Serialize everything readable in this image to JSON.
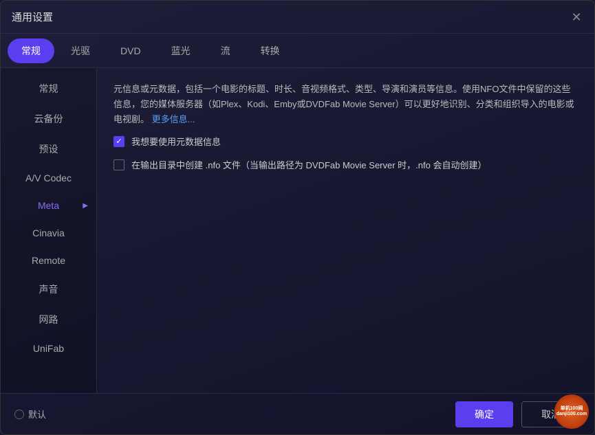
{
  "window": {
    "title": "通用设置"
  },
  "tabs": [
    {
      "label": "常规",
      "active": true
    },
    {
      "label": "光驱",
      "active": false
    },
    {
      "label": "DVD",
      "active": false
    },
    {
      "label": "蓝光",
      "active": false
    },
    {
      "label": "流",
      "active": false
    },
    {
      "label": "转换",
      "active": false
    }
  ],
  "sidebar": {
    "items": [
      {
        "label": "常规",
        "active": false
      },
      {
        "label": "云备份",
        "active": false
      },
      {
        "label": "预设",
        "active": false
      },
      {
        "label": "A/V Codec",
        "active": false
      },
      {
        "label": "Meta",
        "active": true,
        "hasArrow": true
      },
      {
        "label": "Cinavia",
        "active": false
      },
      {
        "label": "Remote",
        "active": false
      },
      {
        "label": "声音",
        "active": false
      },
      {
        "label": "网路",
        "active": false
      },
      {
        "label": "UniFab",
        "active": false
      }
    ]
  },
  "content": {
    "info_paragraph": "元信息或元数据，包括一个电影的标题、时长、音视频格式、类型、导演和演员等信息。使用NFO文件中保留的这些信息，您的媒体服务器（如Plex、Kodi、Emby或DVDFab Movie Server）可以更好地识别、分类和组织导入的电影或电视剧。",
    "more_info_label": "更多信息...",
    "checkbox1": {
      "label": "我想要使用元数据信息",
      "checked": true
    },
    "checkbox2": {
      "label": "在输出目录中创建 .nfo 文件（当输出路径为 DVDFab Movie Server 时，.nfo 会自动创建）",
      "checked": false
    }
  },
  "footer": {
    "default_label": "默认",
    "confirm_label": "确定",
    "cancel_label": "取消"
  },
  "watermark": {
    "text": "单机100网\ndanji100.com"
  }
}
